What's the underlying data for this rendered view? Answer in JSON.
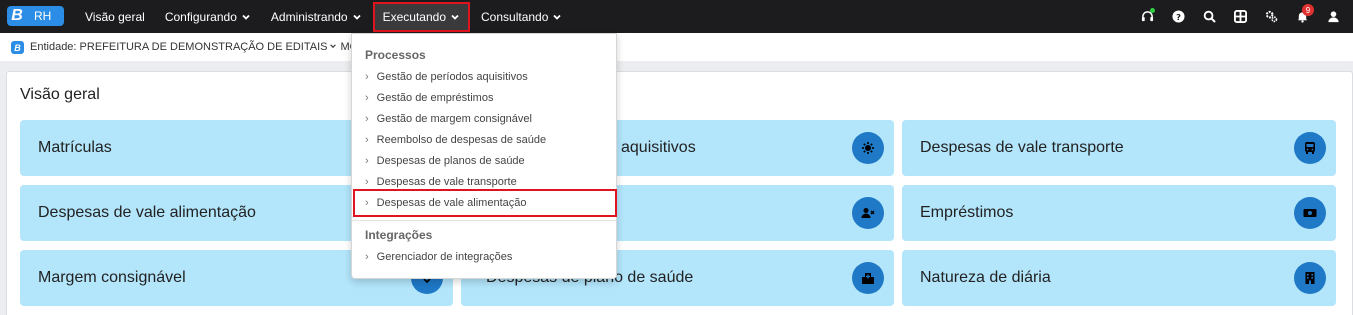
{
  "app": {
    "logo_letter": "B",
    "logo_text": "RH"
  },
  "nav": {
    "items": [
      {
        "label": "Visão geral",
        "has_chevron": false
      },
      {
        "label": "Configurando",
        "has_chevron": true
      },
      {
        "label": "Administrando",
        "has_chevron": true
      },
      {
        "label": "Executando",
        "has_chevron": true,
        "active": true
      },
      {
        "label": "Consultando",
        "has_chevron": true
      }
    ]
  },
  "header_icons": [
    {
      "icon": "headset-icon",
      "status": "online"
    },
    {
      "icon": "help-icon"
    },
    {
      "icon": "search-icon"
    },
    {
      "icon": "grid-icon"
    },
    {
      "icon": "gears-icon"
    },
    {
      "icon": "bell-icon",
      "badge": "9"
    },
    {
      "icon": "user-icon"
    }
  ],
  "entity_bar": {
    "icon_letter": "B",
    "entity_text": "Entidade: PREFEITURA DE DEMONSTRAÇÃO DE EDITAIS",
    "module_text": "MÓDU"
  },
  "main": {
    "title": "Visão geral",
    "cards": [
      {
        "label": "Matrículas",
        "icon": null
      },
      {
        "label": "aquisitivos",
        "icon": "sun-gear-icon"
      },
      {
        "label": "Despesas de vale transporte",
        "icon": "bus-icon"
      },
      {
        "label": "Despesas de vale alimentação",
        "icon": null
      },
      {
        "label": "",
        "icon": "user-remove-icon"
      },
      {
        "label": "Empréstimos",
        "icon": "money-icon"
      },
      {
        "label": "Margem consignável",
        "icon": null
      },
      {
        "label": "Despesas de plano de saúde",
        "icon": "hospital-icon"
      },
      {
        "label": "Natureza de diária",
        "icon": "building-icon"
      }
    ]
  },
  "dropdown": {
    "sections": [
      {
        "header": "Processos",
        "items": [
          "Gestão de períodos aquisitivos",
          "Gestão de empréstimos",
          "Gestão de margem consignável",
          "Reembolso de despesas de saúde",
          "Despesas de planos de saúde",
          "Despesas de vale transporte",
          "Despesas de vale alimentação"
        ],
        "highlighted_index": 6
      },
      {
        "header": "Integrações",
        "items": [
          "Gerenciador de integrações"
        ]
      }
    ],
    "item_arrow": "›"
  },
  "colors": {
    "topbar": "#1c1c1e",
    "brand": "#2b8de6",
    "card_bg": "#b3e5fb",
    "card_icon_bg": "#1f79c6",
    "highlight": "#e0141e"
  }
}
